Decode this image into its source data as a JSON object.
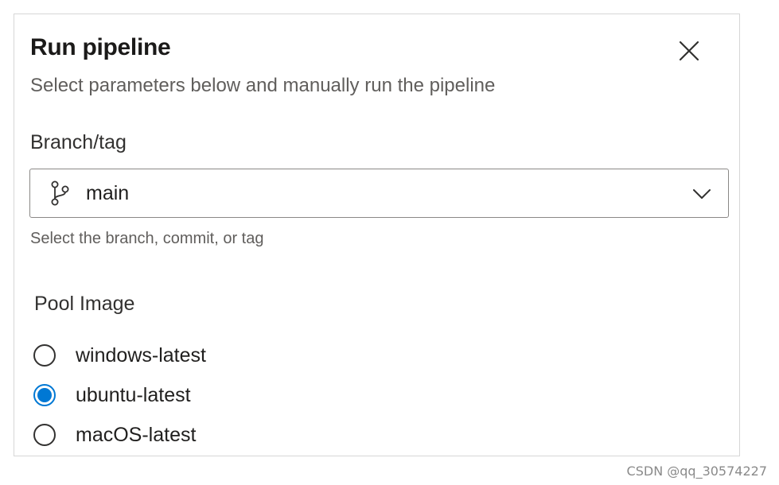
{
  "dialog": {
    "title": "Run pipeline",
    "subtitle": "Select parameters below and manually run the pipeline",
    "close_icon": "close-icon"
  },
  "branch": {
    "label": "Branch/tag",
    "value": "main",
    "icon": "git-branch-icon",
    "helper": "Select the branch, commit, or tag"
  },
  "pool": {
    "label": "Pool Image",
    "options": [
      {
        "label": "windows-latest",
        "selected": false
      },
      {
        "label": "ubuntu-latest",
        "selected": true
      },
      {
        "label": "macOS-latest",
        "selected": false
      }
    ]
  },
  "colors": {
    "accent": "#0078d4",
    "border": "#8a8886",
    "secondary_text": "#605e5c"
  },
  "watermark": "CSDN @qq_30574227"
}
